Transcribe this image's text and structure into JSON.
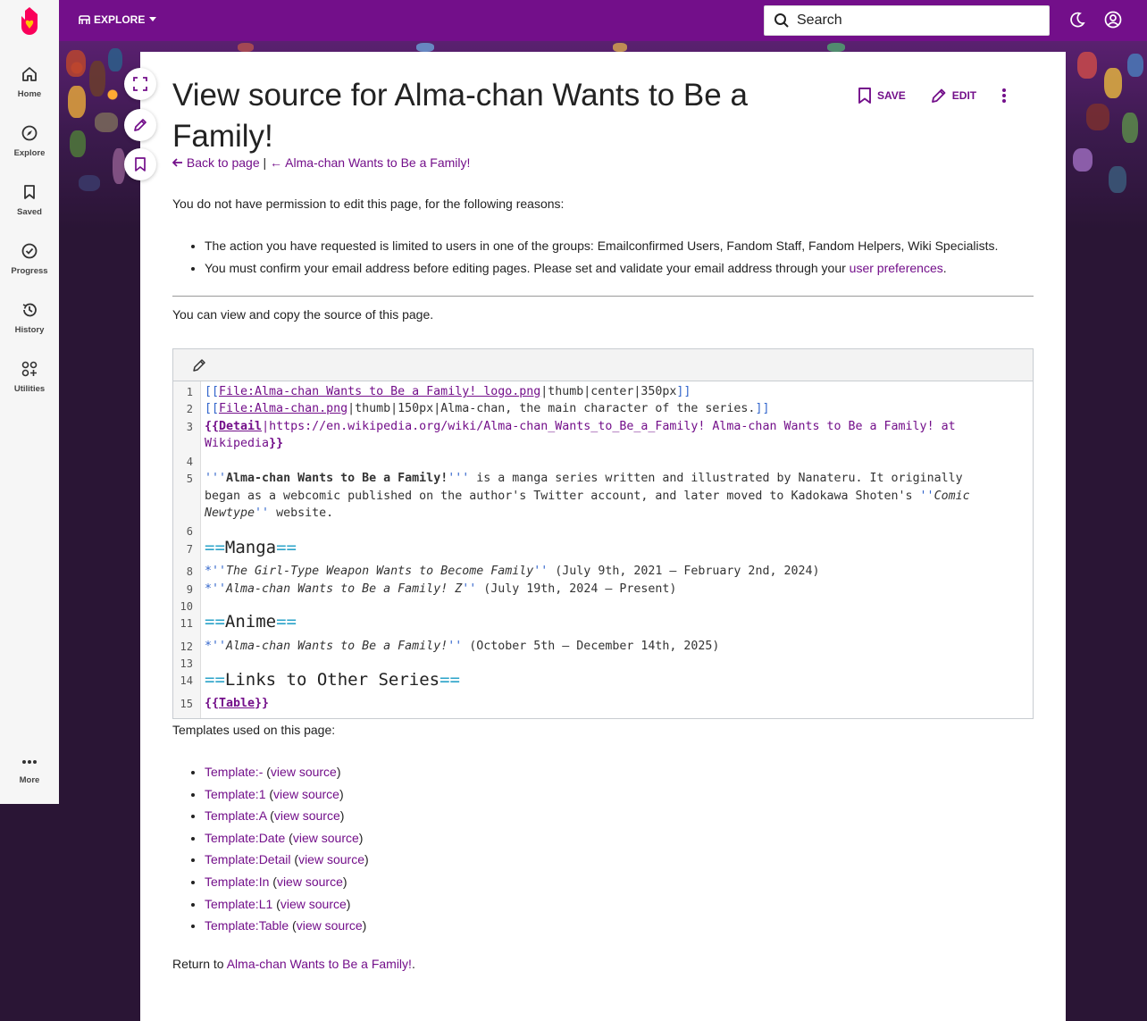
{
  "rail": {
    "items": [
      {
        "label": "Home"
      },
      {
        "label": "Explore"
      },
      {
        "label": "Saved"
      },
      {
        "label": "Progress"
      },
      {
        "label": "History"
      },
      {
        "label": "Utilities"
      },
      {
        "label": "More"
      }
    ]
  },
  "topbar": {
    "explore_label": "EXPLORE",
    "search_label": "Search"
  },
  "page": {
    "title": "View source for Alma-chan Wants to Be a Family!",
    "save_label": "SAVE",
    "edit_label": "EDIT",
    "back_link": "Back to page",
    "separator": "|",
    "parent_link": "← Alma-chan Wants to Be a Family!",
    "permission_intro": "You do not have permission to edit this page, for the following reasons:",
    "reason_1": "The action you have requested is limited to users in one of the groups: Emailconfirmed Users, Fandom Staff, Fandom Helpers, Wiki Specialists.",
    "reason_2_text": "You must confirm your email address before editing pages. Please set and validate your email address through your",
    "reason_2_link": "user preferences",
    "reason_2_end": ".",
    "view_copy": "You can view and copy the source of this page.",
    "templates_heading": "Templates used on this page:",
    "view_source_label": "view source",
    "templates": [
      "Template:-",
      "Template:1",
      "Template:A",
      "Template:Date",
      "Template:Detail",
      "Template:In",
      "Template:L1",
      "Template:Table"
    ],
    "return_text": "Return to",
    "return_link": "Alma-chan Wants to Be a Family!",
    "return_end": "."
  },
  "code": {
    "line_numbers": [
      "1",
      "2",
      "3",
      "4",
      "5",
      "6",
      "7",
      "8",
      "9",
      "10",
      "11",
      "12",
      "13",
      "14",
      "15"
    ],
    "l1_file": "File:Alma-chan Wants to Be a Family! logo.png",
    "l1_rest": "|thumb|center|350px",
    "l2_file": "File:Alma-chan.png",
    "l2_rest": "|thumb|150px|Alma-chan, the main character of the series.",
    "l3_tpl": "Detail",
    "l3_url": "|https://en.wikipedia.org/wiki/Alma-chan_Wants_to_Be_a_Family! Alma-chan Wants to Be a Family! at",
    "l3_url2": "Wikipedia",
    "l5_bold": "Alma-chan Wants to Be a Family!",
    "l5_rest": " is a manga series written and illustrated by Nanateru. It originally",
    "l5_line2_a": "began as a webcomic published on the author's Twitter account, and later moved to Kadokawa Shoten's ",
    "l5_it1": "Comic",
    "l5_it2": "Newtype",
    "l5_end": " website.",
    "h_manga": "Manga",
    "l8_it": "The Girl-Type Weapon Wants to Become Family",
    "l8_rest": " (July 9th, 2021 – February 2nd, 2024)",
    "l9_it": "Alma-chan Wants to Be a Family! Z",
    "l9_rest": " (July 19th, 2024 – Present)",
    "h_anime": "Anime",
    "l12_it": "Alma-chan Wants to Be a Family!",
    "l12_rest": " (October 5th – December 14th, 2025)",
    "h_links": "Links to Other Series",
    "l15_tpl": "Table"
  }
}
